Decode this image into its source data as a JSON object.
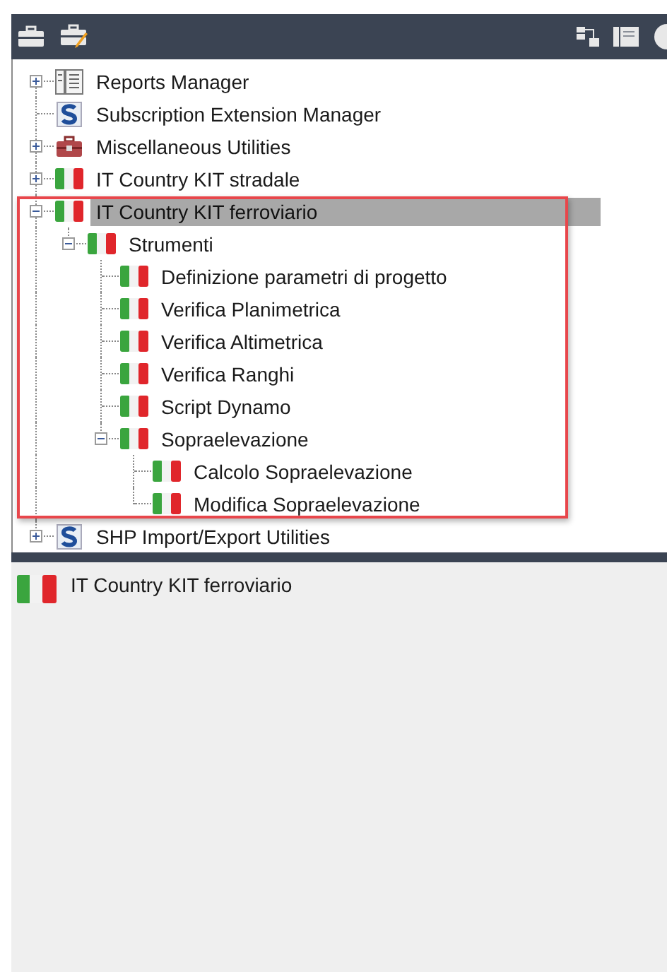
{
  "toolbar": {
    "left_buttons": [
      {
        "kind": "toolbox"
      },
      {
        "kind": "toolbox-edit"
      }
    ],
    "right_buttons": [
      {
        "kind": "tree"
      },
      {
        "kind": "panel"
      },
      {
        "kind": "help"
      }
    ]
  },
  "tree": {
    "items": [
      {
        "label": "Reports Manager",
        "kind": "report",
        "expanded": false,
        "selected": false
      },
      {
        "label": "Subscription Extension Manager",
        "kind": "s-logo",
        "selected": false
      },
      {
        "label": "Miscellaneous Utilities",
        "kind": "toolbox",
        "expanded": false,
        "selected": false
      },
      {
        "label": "IT Country KIT stradale",
        "kind": "flag",
        "expanded": false,
        "selected": false
      },
      {
        "label": "IT Country KIT ferroviario",
        "kind": "flag",
        "expanded": true,
        "selected": true,
        "children": [
          {
            "label": "Strumenti",
            "kind": "flag",
            "expanded": true,
            "selected": false,
            "children": [
              {
                "label": "Definizione parametri di progetto",
                "kind": "flag",
                "selected": false
              },
              {
                "label": "Verifica Planimetrica",
                "kind": "flag",
                "selected": false
              },
              {
                "label": "Verifica Altimetrica",
                "kind": "flag",
                "selected": false
              },
              {
                "label": "Verifica Ranghi",
                "kind": "flag",
                "selected": false
              },
              {
                "label": "Script Dynamo",
                "kind": "flag",
                "selected": false
              },
              {
                "label": "Sopraelevazione",
                "kind": "flag",
                "expanded": true,
                "selected": false,
                "children": [
                  {
                    "label": "Calcolo Sopraelevazione",
                    "kind": "flag",
                    "selected": false
                  },
                  {
                    "label": "Modifica Sopraelevazione",
                    "kind": "flag",
                    "selected": false
                  }
                ]
              }
            ]
          }
        ]
      },
      {
        "label": "SHP Import/Export Utilities",
        "kind": "s-logo",
        "expanded": false,
        "selected": false
      }
    ]
  },
  "details": {
    "kind": "flag",
    "text": "IT Country KIT ferroviario"
  }
}
